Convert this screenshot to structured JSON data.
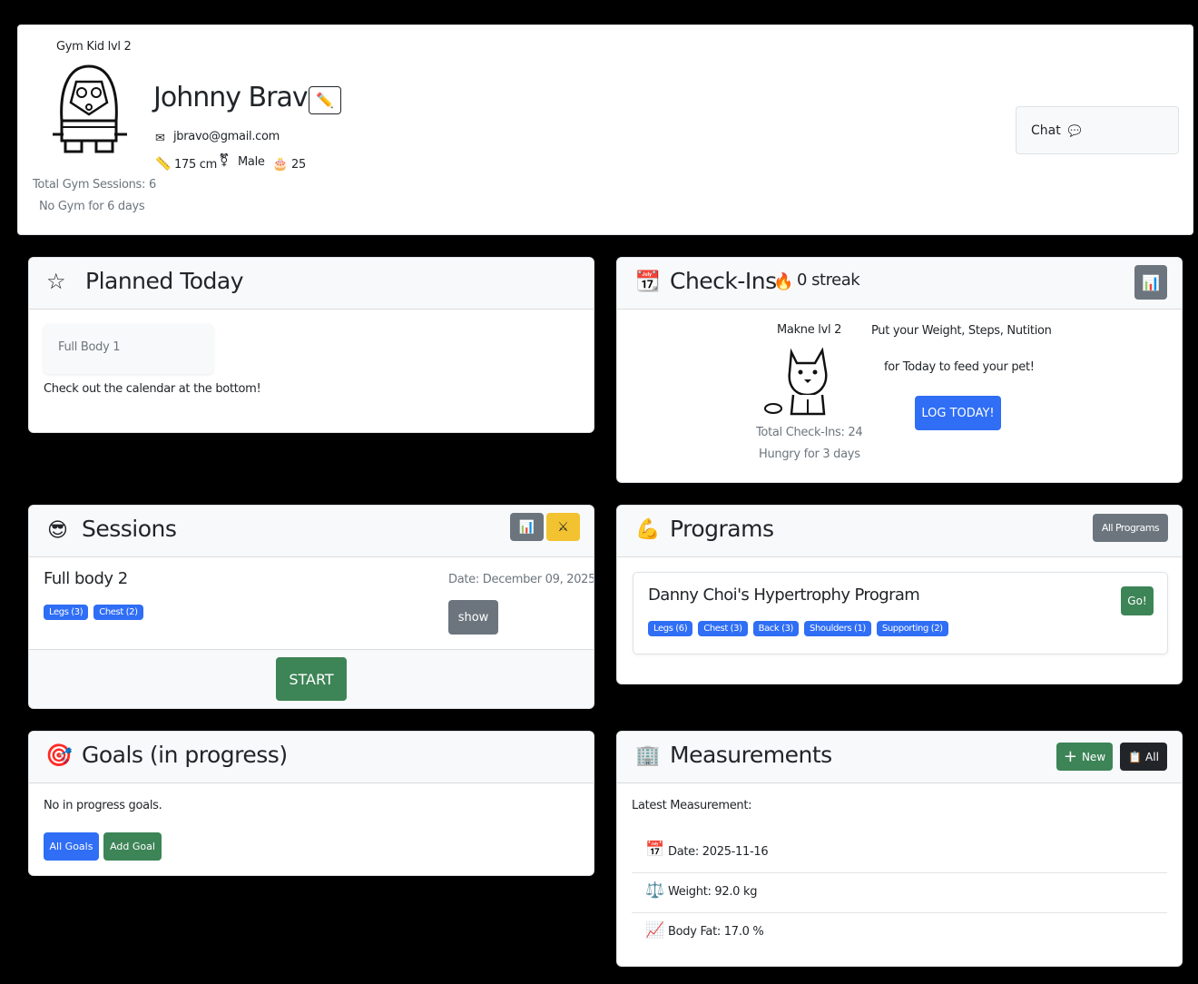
{
  "profile": {
    "level": "Gym Kid lvl 2",
    "name": "Johnny Bravo",
    "edit_icon": "✏️",
    "email": "jbravo@gmail.com",
    "height": "175 cm",
    "gender": "Male",
    "age": "25",
    "sessions_total": "Total Gym Sessions: 6",
    "no_gym": "No Gym for 6 days",
    "chat_label": "Chat"
  },
  "planned": {
    "title": "Planned Today",
    "item": "Full Body 1",
    "note": "Check out the calendar at the bottom!"
  },
  "checkins": {
    "title": "Check-Ins",
    "streak": "0 streak",
    "pet_level": "Makne lvl 2",
    "total": "Total Check-Ins: 24",
    "hungry": "Hungry for 3 days",
    "prompt_line1": "Put your Weight, Steps, Nutition",
    "prompt_line2": "for Today to feed your pet!",
    "log_label": "LOG TODAY!",
    "chart_icon": "📊"
  },
  "sessions": {
    "title": "Sessions",
    "name": "Full body 2",
    "date": "Date: December 09, 2025",
    "badges": [
      "Legs (3)",
      "Chest (2)"
    ],
    "show_label": "show",
    "start_label": "START",
    "chart_icon": "📊",
    "tools_icon": "⚔"
  },
  "programs": {
    "title": "Programs",
    "all_label": "All Programs",
    "program_name": "Danny Choi's Hypertrophy Program",
    "go_label": "Go!",
    "badges": [
      "Legs (6)",
      "Chest (3)",
      "Back (3)",
      "Shoulders (1)",
      "Supporting (2)"
    ]
  },
  "goals": {
    "title": "Goals (in progress)",
    "empty": "No in progress goals.",
    "all_label": "All Goals",
    "add_label": "Add Goal"
  },
  "measurements": {
    "title": "Measurements",
    "new_label": "New",
    "all_label": "All",
    "latest": "Latest Measurement:",
    "date": "Date: 2025-11-16",
    "weight": "Weight: 92.0 kg",
    "bodyfat": "Body Fat: 17.0 %",
    "date_icon": "📅",
    "weight_icon": "⚖️",
    "bodyfat_icon": "📈",
    "new_icon": "+",
    "all_icon": "📋"
  }
}
